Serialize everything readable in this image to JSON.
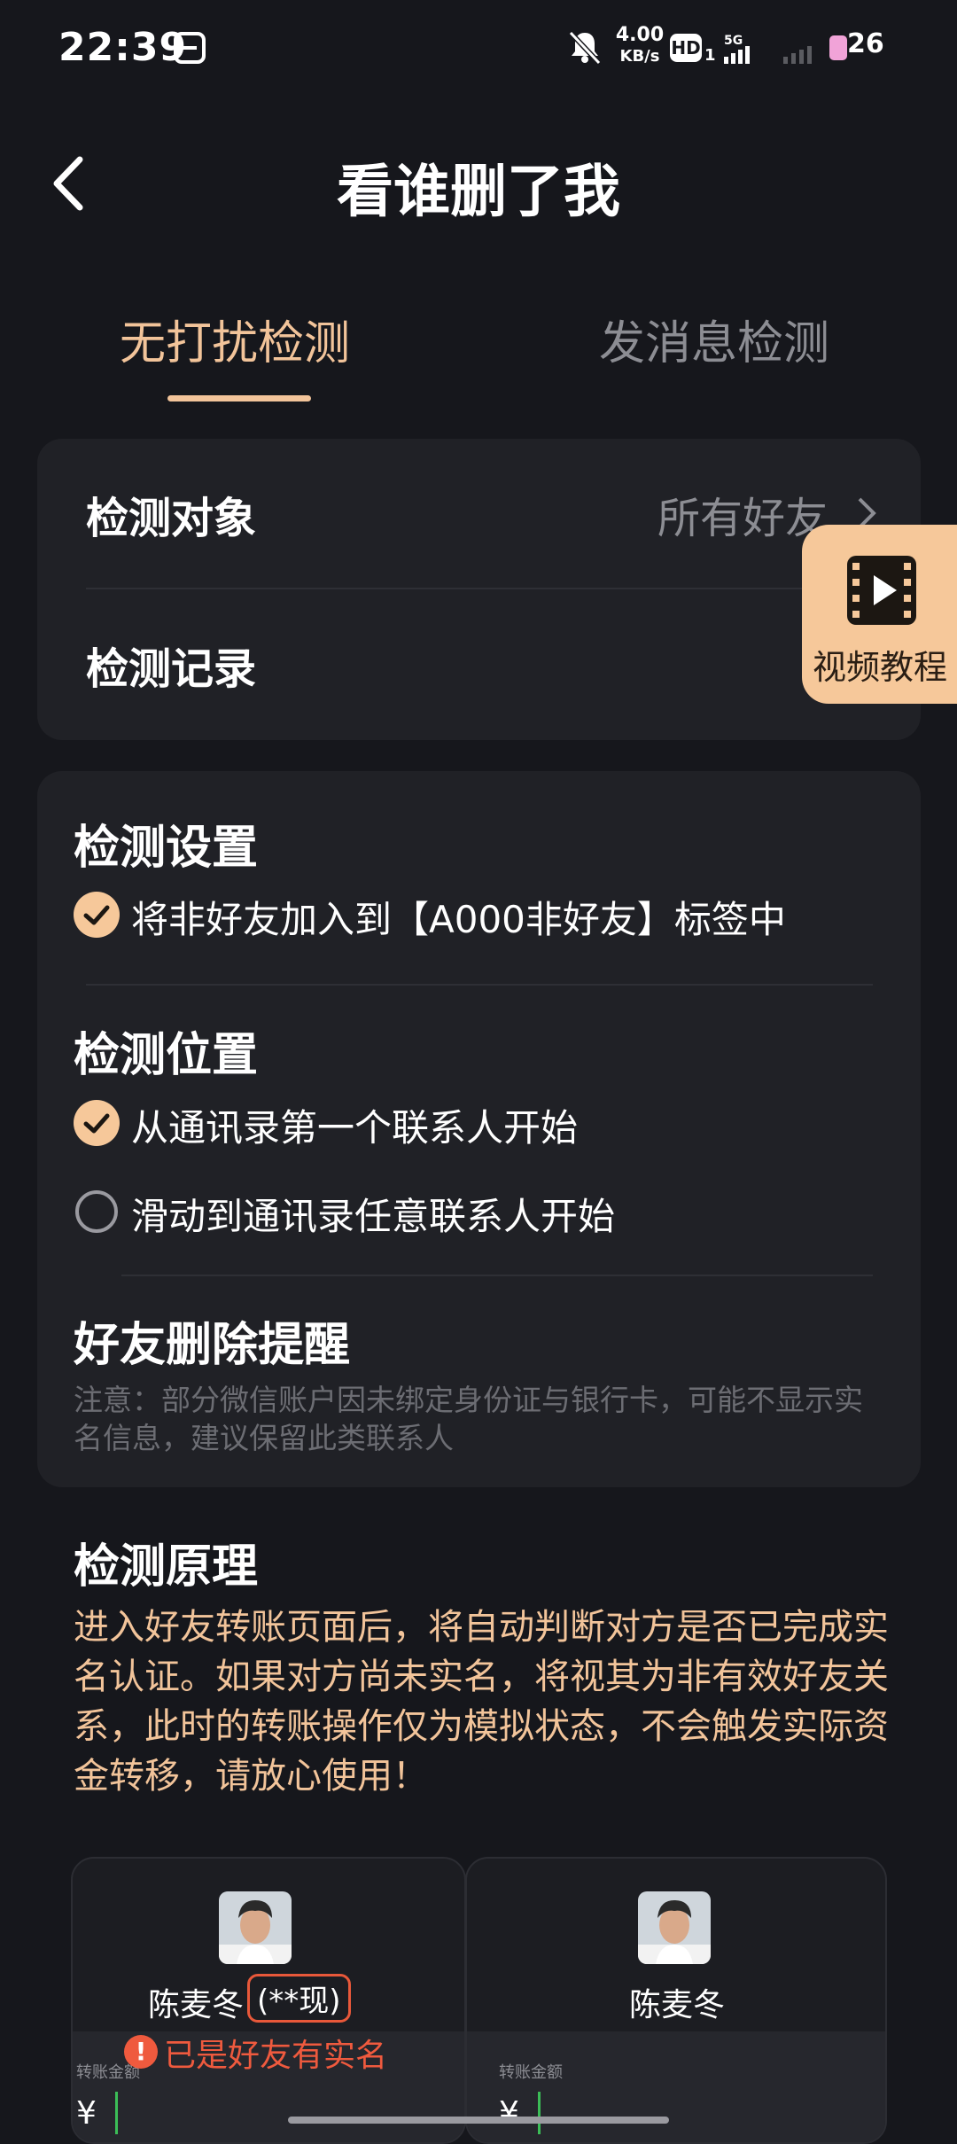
{
  "status_bar": {
    "time": "22:39",
    "net_speed_value": "4.00",
    "net_speed_unit": "KB/s",
    "hd_label": "HD",
    "hd_sub": "1",
    "network": "5G",
    "battery": "26",
    "icons": [
      "app-notification-icon",
      "mute-bell-icon",
      "signal-icon",
      "battery-icon"
    ]
  },
  "header": {
    "title": "看谁删了我",
    "back_icon": "chevron-left-icon"
  },
  "tabs": [
    {
      "label": "无打扰检测",
      "active": true
    },
    {
      "label": "发消息检测",
      "active": false
    }
  ],
  "target_card": {
    "detect_target_label": "检测对象",
    "detect_target_value": "所有好友",
    "detect_record_label": "检测记录"
  },
  "video_tutorial": {
    "label": "视频教程",
    "icon": "film-play-icon"
  },
  "settings": {
    "detect_settings_title": "检测设置",
    "option_add_label": {
      "text": "将非好友加入到【A000非好友】标签中",
      "checked": true
    },
    "detect_position_title": "检测位置",
    "position_options": [
      {
        "text": "从通讯录第一个联系人开始",
        "checked": true
      },
      {
        "text": "滑动到通讯录任意联系人开始",
        "checked": false
      }
    ],
    "reminder_title": "好友删除提醒",
    "reminder_note": "注意：部分微信账户因未绑定身份证与银行卡，可能不显示实名信息，建议保留此类联系人"
  },
  "principle": {
    "title": "检测原理",
    "body": "进入好友转账页面后，将自动判断对方是否已完成实名认证。如果对方尚未实名，将视其为非有效好友关系，此时的转账操作仅为模拟状态，不会触发实际资金转移，请放心使用！"
  },
  "examples": [
    {
      "name": "陈麦冬",
      "badge": "(**现)",
      "amount_label": "转账金额",
      "currency": "¥",
      "warning": "已是好友有实名"
    },
    {
      "name": "陈麦冬",
      "amount_label": "转账金额",
      "currency": "¥"
    }
  ],
  "colors": {
    "accent": "#f2c49a",
    "background": "#16171c",
    "card": "#202126",
    "warning": "#ef5a3e"
  }
}
